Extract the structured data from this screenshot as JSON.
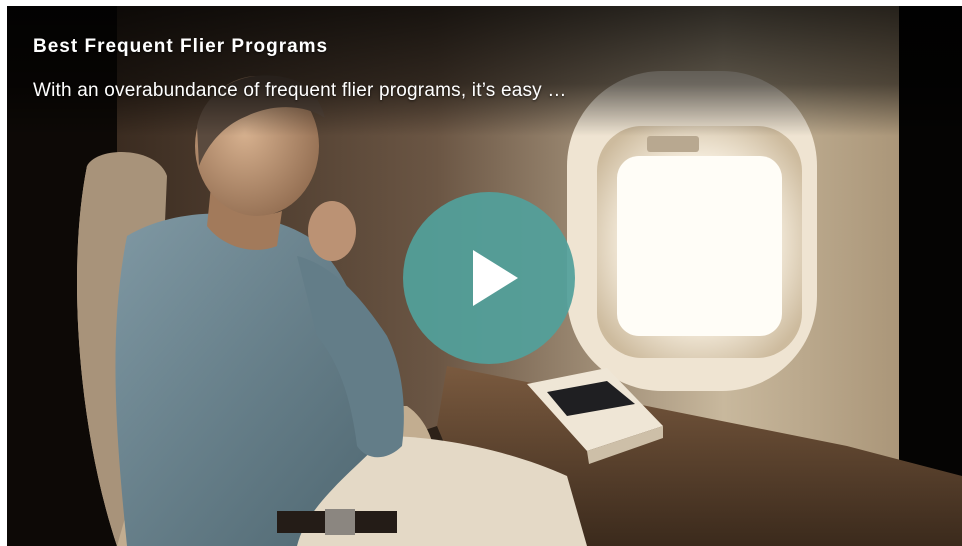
{
  "video": {
    "title": "Best Frequent Flier Programs",
    "description": "With an overabundance of frequent flier programs, it’s easy …",
    "play_icon": "play-icon",
    "accent_color": "#52a09b"
  }
}
